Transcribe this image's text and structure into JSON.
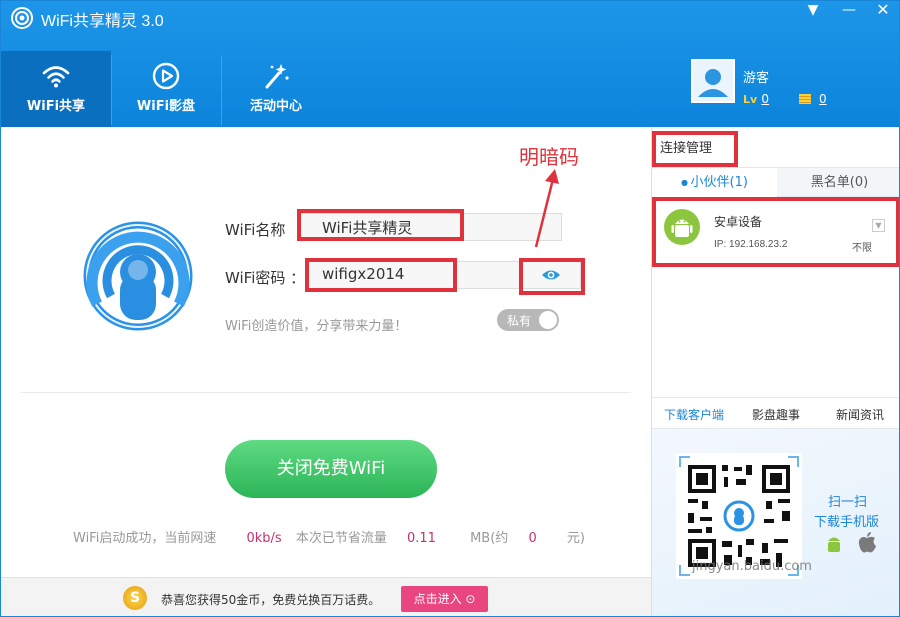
{
  "header": {
    "title": "WiFi共享精灵 3.0",
    "nav": [
      {
        "label": "WiFi共享",
        "icon": "wifi-icon"
      },
      {
        "label": "WiFi影盘",
        "icon": "play-icon"
      },
      {
        "label": "活动中心",
        "icon": "magic-wand-icon"
      }
    ],
    "user": {
      "name": "游客",
      "level_badge": "Lv",
      "level": "0",
      "coins": "0"
    }
  },
  "main": {
    "name_label": "WiFi名称",
    "name_value": "WiFi共享精灵",
    "password_label": "WiFi密码 ：",
    "password_value": "wifigx2014",
    "slogan": "WiFi创造价值，分享带来力量！",
    "private_label": "私有",
    "annotation": "明暗码",
    "close_button": "关闭免费WiFi",
    "status": {
      "prefix": "WiFi启动成功，当前网速",
      "speed": "0kb/s",
      "saved_label": "本次已节省流量",
      "saved": "0.11",
      "unit": "MB(约",
      "money": "0",
      "money_unit": "元)"
    }
  },
  "footer": {
    "coin_symbol": "S",
    "text": "恭喜您获得50金币，免费兑换百万话费。",
    "button": "点击进入 ⊙"
  },
  "right": {
    "title": "连接管理",
    "tabs": [
      "小伙伴(1)",
      "黑名单(0)"
    ],
    "device": {
      "name": "安卓设备",
      "ip": "IP: 192.168.23.2",
      "limit": "不限"
    },
    "lower_tabs": [
      "下载客户端",
      "影盘趣事",
      "新闻资讯"
    ],
    "promo": {
      "line1": "扫一扫",
      "line2": "下载手机版",
      "watermark": "jingyan.baidu.com"
    }
  },
  "colors": {
    "accent": "#1a86d8",
    "annotation": "#e0323c",
    "button": "#2bb457",
    "pink": "#e9457f"
  }
}
